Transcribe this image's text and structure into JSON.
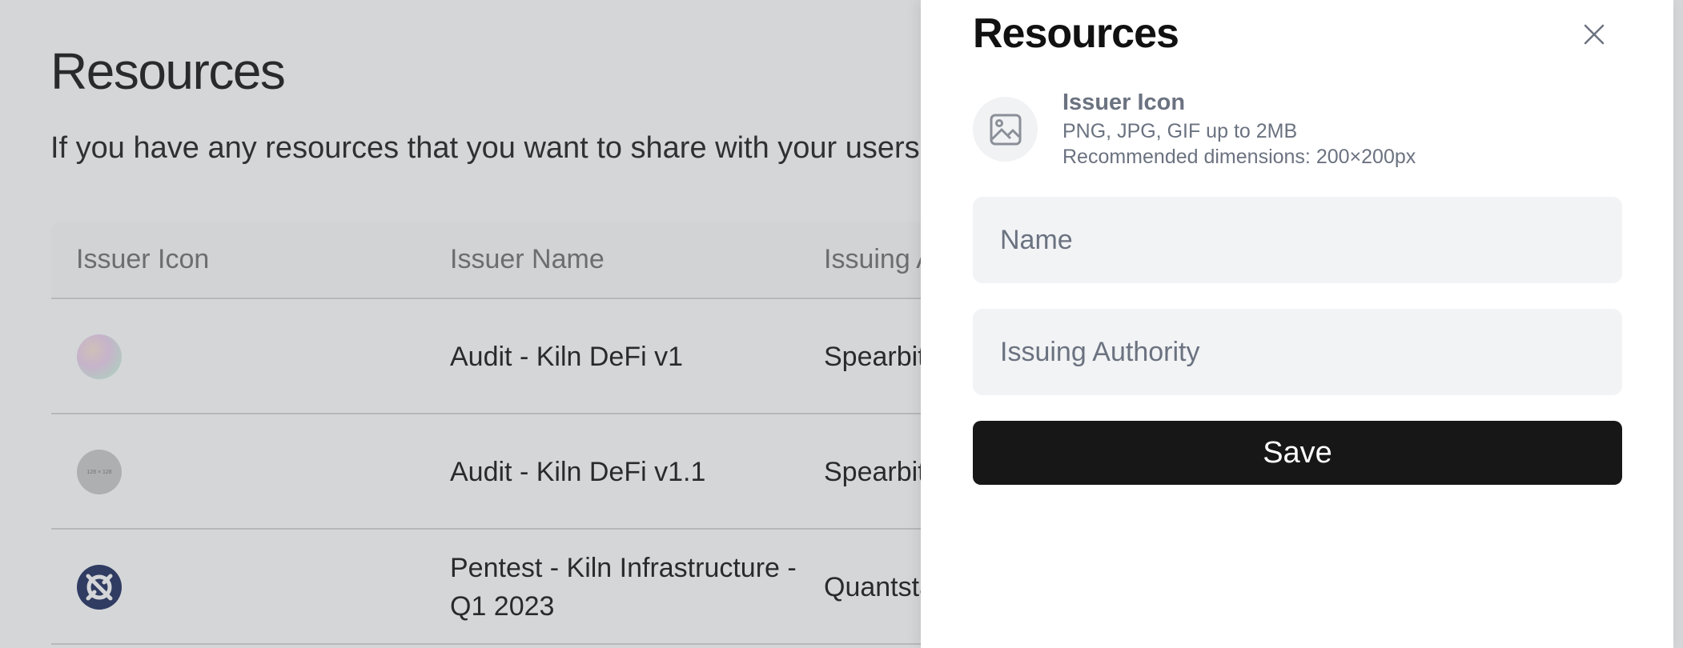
{
  "page": {
    "title": "Resources",
    "description": "If you have any resources that you want to share with your users, you c"
  },
  "table": {
    "headers": [
      "Issuer Icon",
      "Issuer Name",
      "Issuing A"
    ],
    "rows": [
      {
        "icon": "gradient-logo",
        "name_line1": "Audit - Kiln DeFi v1",
        "name_line2": "",
        "authority": "Spearbit"
      },
      {
        "icon": "placeholder-128",
        "icon_text": "128 × 128",
        "name_line1": "Audit - Kiln DeFi v1.1",
        "name_line2": "",
        "authority": "Spearbit/"
      },
      {
        "icon": "quantstamp-logo",
        "name_line1": "Pentest - Kiln Infrastructure -",
        "name_line2": "Q1 2023",
        "authority": "Quantsta"
      }
    ]
  },
  "drawer": {
    "title": "Resources",
    "close_icon": "close-icon",
    "upload": {
      "icon": "image-icon",
      "label": "Issuer Icon",
      "hint_formats": "PNG, JPG, GIF up to 2MB",
      "hint_dimensions": "Recommended dimensions: 200×200px"
    },
    "name_field": {
      "placeholder": "Name",
      "value": ""
    },
    "authority_field": {
      "placeholder": "Issuing Authority",
      "value": ""
    },
    "save_label": "Save"
  },
  "colors": {
    "overlay": "#646a73",
    "button_bg": "#171717",
    "field_bg": "#f2f3f5",
    "muted_text": "#6b7280"
  }
}
